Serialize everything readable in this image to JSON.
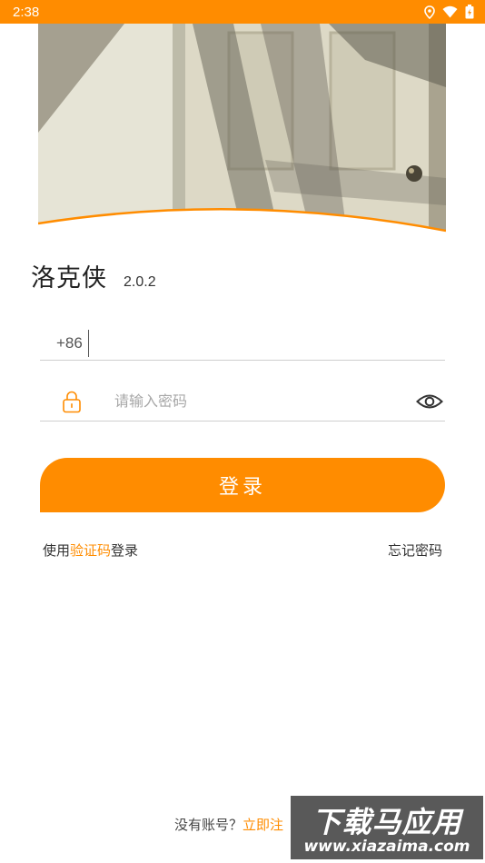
{
  "status_bar": {
    "time": "2:38",
    "icons": [
      "location-icon",
      "wifi-icon",
      "battery-icon"
    ]
  },
  "hero": {
    "image": "door-photo"
  },
  "app": {
    "name": "洛克侠",
    "version": "2.0.2"
  },
  "phone_field": {
    "country_code": "+86",
    "value": ""
  },
  "password_field": {
    "placeholder": "请输入密码",
    "value": ""
  },
  "login": {
    "button_label": "登录"
  },
  "alt_login": {
    "prefix": "使用",
    "link": "验证码",
    "suffix": "登录"
  },
  "forgot": {
    "label": "忘记密码"
  },
  "register": {
    "prompt": "没有账号？",
    "link": "立即注"
  },
  "watermark": {
    "title": "下载马应用",
    "url": "www.xiazaima.com"
  },
  "colors": {
    "accent": "#FF8C00",
    "divider": "#cfcfcf"
  }
}
